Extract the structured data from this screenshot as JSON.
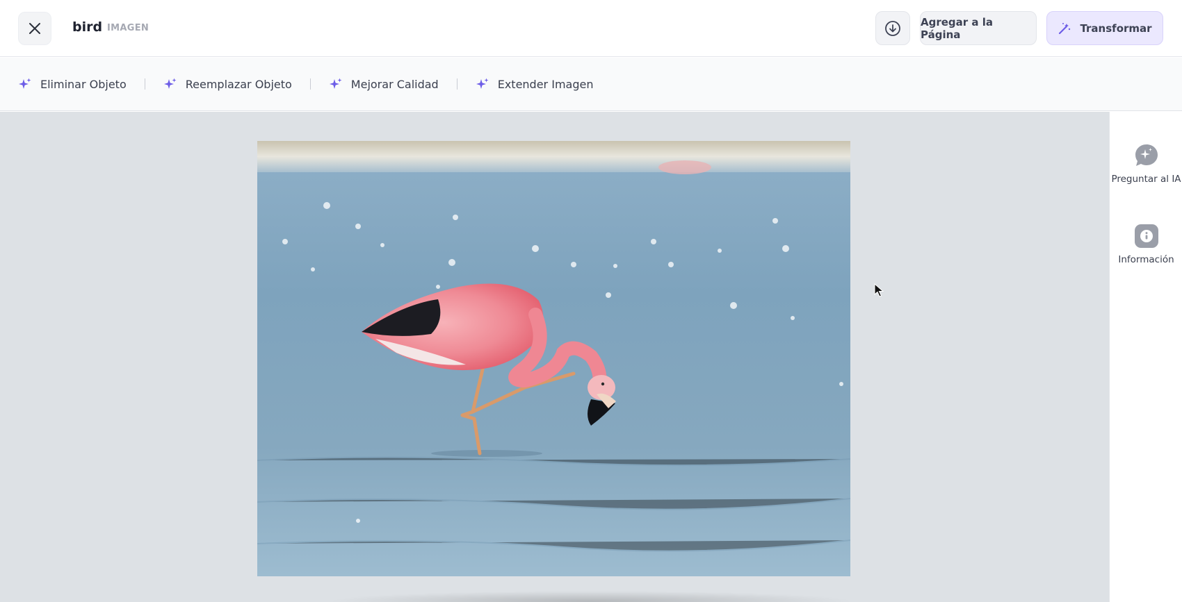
{
  "header": {
    "title": "bird",
    "subtitle": "IMAGEN",
    "add_label": "Agregar a la Página",
    "transform_label": "Transformar"
  },
  "toolbar": {
    "items": [
      {
        "label": "Eliminar Objeto",
        "icon": "sparkle-icon"
      },
      {
        "label": "Reemplazar Objeto",
        "icon": "sparkle-icon"
      },
      {
        "label": "Mejorar Calidad",
        "icon": "sparkle-icon"
      },
      {
        "label": "Extender Imagen",
        "icon": "sparkle-icon"
      }
    ]
  },
  "side_panel": {
    "items": [
      {
        "label": "Preguntar al IA",
        "icon": "ai-chat-icon"
      },
      {
        "label": "Información",
        "icon": "info-icon"
      }
    ]
  },
  "colors": {
    "accent": "#6c5ce7",
    "accent_bg": "#ebe8fe",
    "canvas_bg": "#dde1e5"
  },
  "image": {
    "subject": "flamingo-photo"
  }
}
